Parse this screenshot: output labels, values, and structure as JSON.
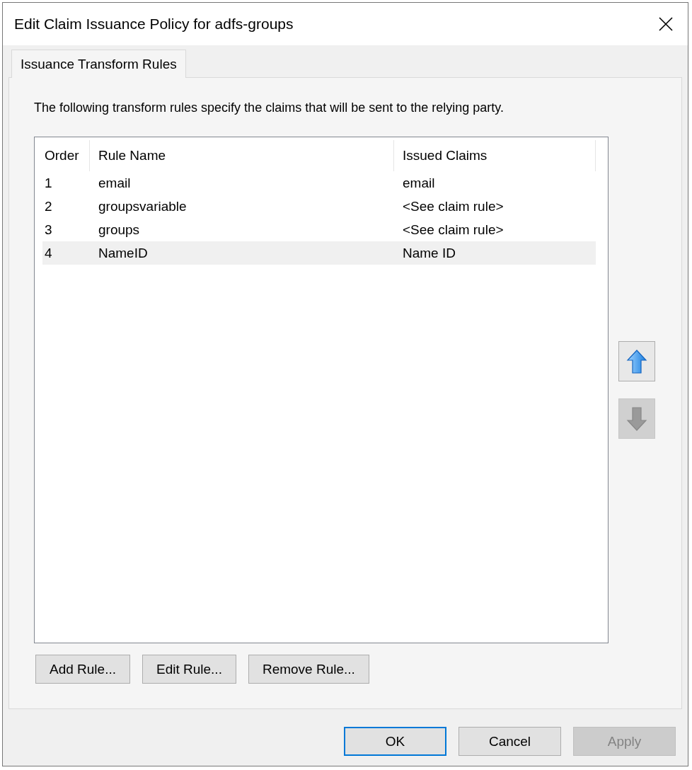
{
  "window": {
    "title": "Edit Claim Issuance Policy for adfs-groups"
  },
  "tabs": [
    {
      "label": "Issuance Transform Rules",
      "selected": true
    }
  ],
  "description": "The following transform rules specify the claims that will be sent to the relying party.",
  "table": {
    "columns": [
      "Order",
      "Rule Name",
      "Issued Claims"
    ],
    "rows": [
      {
        "order": "1",
        "rule_name": "email",
        "issued_claims": "email",
        "selected": false
      },
      {
        "order": "2",
        "rule_name": "groupsvariable",
        "issued_claims": "<See claim rule>",
        "selected": false
      },
      {
        "order": "3",
        "rule_name": "groups",
        "issued_claims": "<See claim rule>",
        "selected": false
      },
      {
        "order": "4",
        "rule_name": "NameID",
        "issued_claims": "Name ID",
        "selected": true
      }
    ]
  },
  "move_buttons": [
    {
      "kind": "up",
      "disabled": false
    },
    {
      "kind": "down",
      "disabled": true
    }
  ],
  "rule_buttons": [
    {
      "label": "Add Rule...",
      "disabled": false
    },
    {
      "label": "Edit Rule...",
      "disabled": false
    },
    {
      "label": "Remove Rule...",
      "disabled": false
    }
  ],
  "dialog_buttons": [
    {
      "label": "OK",
      "default": true,
      "disabled": false
    },
    {
      "label": "Cancel",
      "default": false,
      "disabled": false
    },
    {
      "label": "Apply",
      "default": false,
      "disabled": true
    }
  ]
}
